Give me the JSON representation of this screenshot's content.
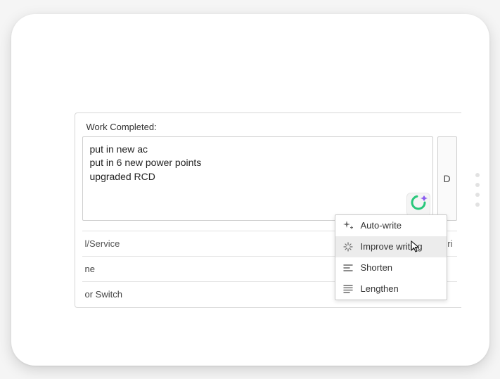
{
  "field": {
    "label": "Work Completed:",
    "value": "put in new ac\nput in 6 new power points\nupgraded RCD"
  },
  "side_button_label": "D",
  "table": {
    "header_service": "l/Service",
    "header_price": "Pri",
    "row1_service": "ne",
    "row2_service": "or Switch"
  },
  "ai_menu": {
    "items": [
      {
        "label": "Auto-write"
      },
      {
        "label": "Improve writing"
      },
      {
        "label": "Shorten"
      },
      {
        "label": "Lengthen"
      }
    ],
    "hovered_index": 1
  }
}
